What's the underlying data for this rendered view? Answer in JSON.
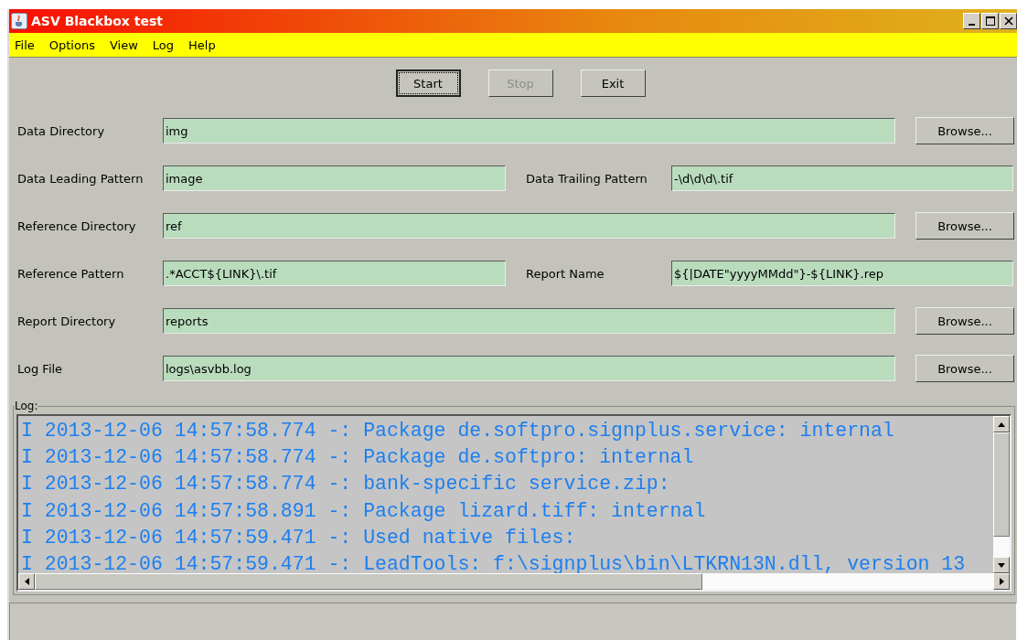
{
  "window": {
    "title": "ASV Blackbox test"
  },
  "menu": [
    "File",
    "Options",
    "View",
    "Log",
    "Help"
  ],
  "buttons": [
    {
      "label": "Start",
      "disabled": false,
      "focused": true
    },
    {
      "label": "Stop",
      "disabled": true,
      "focused": false
    },
    {
      "label": "Exit",
      "disabled": false,
      "focused": false
    }
  ],
  "rows": [
    {
      "kind": "browse",
      "label": "Data Directory",
      "value": "img",
      "button": "Browse..."
    },
    {
      "kind": "pair",
      "label": "Data Leading Pattern",
      "value": "image",
      "label2": "Data Trailing Pattern",
      "value2": "-\\d\\d\\d\\.tif"
    },
    {
      "kind": "browse",
      "label": "Reference Directory",
      "value": "ref",
      "button": "Browse..."
    },
    {
      "kind": "pair",
      "label": "Reference Pattern",
      "value": ".*ACCT${LINK}\\.tif",
      "label2": "Report Name",
      "value2": "${|DATE\"yyyyMMdd\"}-${LINK}.rep"
    },
    {
      "kind": "browse",
      "label": "Report Directory",
      "value": "reports",
      "button": "Browse..."
    },
    {
      "kind": "browse",
      "label": "Log File",
      "value": "logs\\asvbb.log",
      "button": "Browse..."
    }
  ],
  "log": {
    "title": "Log:",
    "lines": [
      "I 2013-12-06 14:57:58.774 -: Package de.softpro.signplus.service: internal",
      "I 2013-12-06 14:57:58.774 -: Package de.softpro: internal",
      "I 2013-12-06 14:57:58.774 -: bank-specific service.zip:",
      "I 2013-12-06 14:57:58.891 -: Package lizard.tiff: internal",
      "I 2013-12-06 14:57:59.471 -: Used native files:",
      "I 2013-12-06 14:57:59.471 -: LeadTools: f:\\signplus\\bin\\LTKRN13N.dll, version 13"
    ]
  }
}
